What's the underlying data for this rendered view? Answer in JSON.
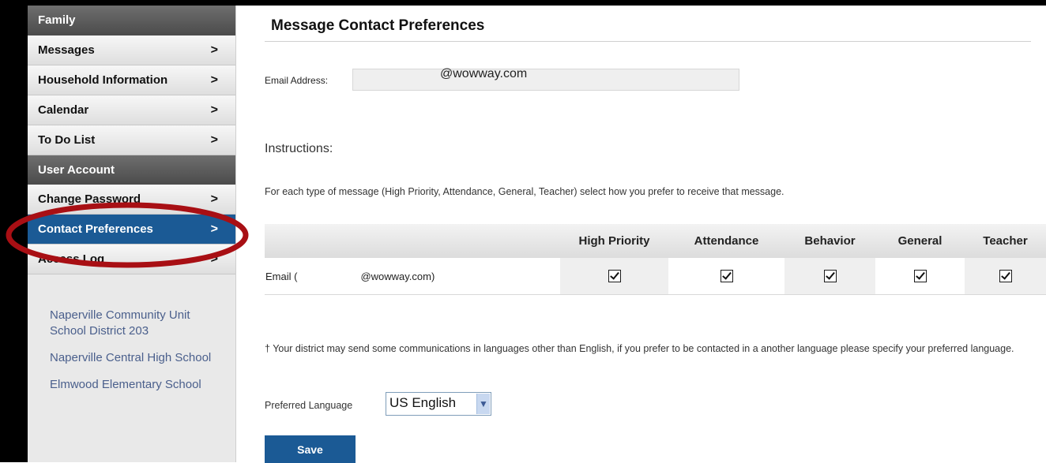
{
  "sidebar": {
    "sections": [
      {
        "header": "Family",
        "items": [
          {
            "label": "Messages"
          },
          {
            "label": "Household Information"
          },
          {
            "label": "Calendar"
          },
          {
            "label": "To Do List"
          }
        ]
      },
      {
        "header": "User Account",
        "items": [
          {
            "label": "Change Password"
          },
          {
            "label": "Contact Preferences",
            "active": true
          },
          {
            "label": "Access Log"
          }
        ]
      }
    ],
    "chevron": ">",
    "schools": [
      "Naperville Community Unit School District 203",
      "Naperville Central High School",
      "Elmwood Elementary School"
    ]
  },
  "main": {
    "title": "Message Contact Preferences",
    "email_label": "Email Address:",
    "email_value": "@wowway.com",
    "instructions_title": "Instructions:",
    "instructions_text": "For each type of message (High Priority, Attendance, General, Teacher) select how you prefer to receive that message.",
    "table": {
      "columns": [
        "High Priority",
        "Attendance",
        "Behavior",
        "General",
        "Teacher"
      ],
      "rows": [
        {
          "label_prefix": "Email (",
          "label_value": "@wowway.com)",
          "checked": [
            true,
            true,
            true,
            true,
            true
          ]
        }
      ]
    },
    "language_note": "† Your district may send some communications in languages other than English, if you prefer to be contacted in a another language please specify your preferred language.",
    "language_label": "Preferred Language",
    "language_value": "US English",
    "save_label": "Save"
  },
  "colors": {
    "active_nav": "#1b5a95",
    "annotation": "#a80f14",
    "link": "#4a5f8c"
  }
}
